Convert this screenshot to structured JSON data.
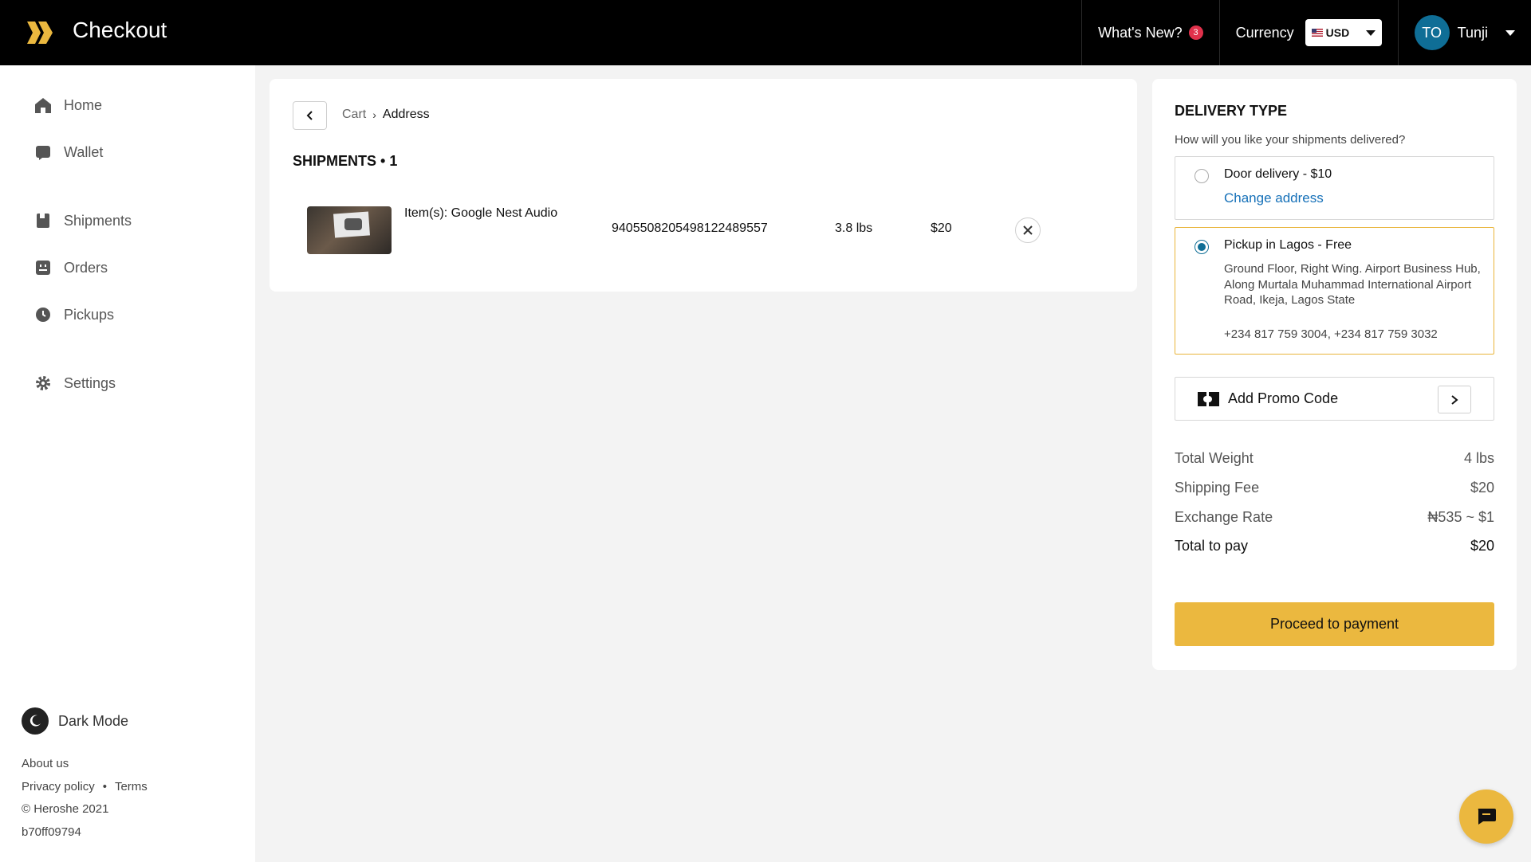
{
  "header": {
    "title": "Checkout",
    "whats_new_label": "What's New?",
    "whats_new_count": "3",
    "currency_label": "Currency",
    "currency_value": "USD",
    "user_initials": "TO",
    "user_name": "Tunji"
  },
  "sidebar": {
    "items": [
      {
        "label": "Home",
        "icon": "home-icon"
      },
      {
        "label": "Wallet",
        "icon": "wallet-icon"
      },
      {
        "label": "Shipments",
        "icon": "shipments-icon"
      },
      {
        "label": "Orders",
        "icon": "orders-icon"
      },
      {
        "label": "Pickups",
        "icon": "pickups-icon"
      },
      {
        "label": "Settings",
        "icon": "gear-icon"
      }
    ],
    "dark_mode_label": "Dark Mode",
    "footer": {
      "about": "About us",
      "privacy": "Privacy policy",
      "separator": "•",
      "terms": "Terms",
      "copyright": "© Heroshe 2021",
      "build": "b70ff09794"
    }
  },
  "main": {
    "breadcrumb": {
      "cart": "Cart",
      "separator": "›",
      "current": "Address"
    },
    "shipments_heading": "SHIPMENTS • 1",
    "shipments": [
      {
        "item_name": "Item(s): Google Nest Audio",
        "tracking_number": "9405508205498122489557",
        "weight": "3.8 lbs",
        "price": "$20"
      }
    ]
  },
  "delivery": {
    "title": "DELIVERY TYPE",
    "subtitle": "How will you like your shipments delivered?",
    "options": [
      {
        "title": "Door delivery - $10",
        "link": "Change address",
        "selected": false
      },
      {
        "title": "Pickup in Lagos - Free",
        "address": "Ground Floor, Right Wing. Airport Business Hub, Along Murtala Muhammad International Airport Road, Ikeja, Lagos State",
        "phone": "+234 817 759 3004, +234 817 759 3032",
        "selected": true
      }
    ],
    "promo_label": "Add Promo Code",
    "summary": {
      "total_weight_label": "Total Weight",
      "total_weight_value": "4 lbs",
      "shipping_fee_label": "Shipping Fee",
      "shipping_fee_value": "$20",
      "exchange_rate_label": "Exchange Rate",
      "exchange_rate_value": "₦535 ~ $1",
      "total_label": "Total to pay",
      "total_value": "$20"
    },
    "pay_button": "Proceed to payment"
  },
  "colors": {
    "accent": "#ebb83f",
    "topbar": "#000000",
    "link": "#1570b8",
    "radio": "#0f6e96",
    "badge": "#e0314b"
  }
}
